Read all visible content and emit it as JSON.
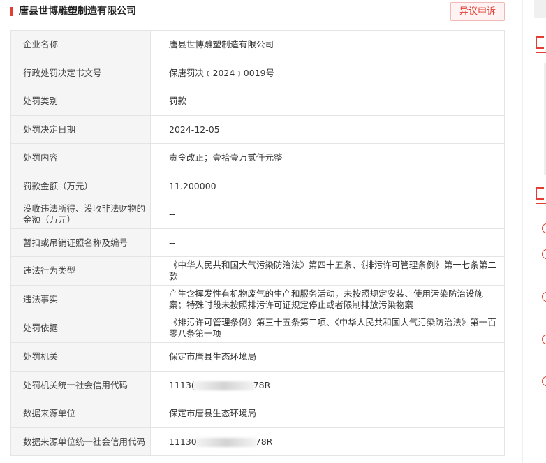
{
  "header": {
    "title": "唐县世博雕塑制造有限公司",
    "appeal_button": "异议申诉"
  },
  "rows": [
    {
      "label": "企业名称",
      "value": "唐县世博雕塑制造有限公司"
    },
    {
      "label": "行政处罚决定书文号",
      "value": "保唐罚决﹝2024﹞0019号"
    },
    {
      "label": "处罚类别",
      "value": "罚款"
    },
    {
      "label": "处罚决定日期",
      "value": "2024-12-05"
    },
    {
      "label": "处罚内容",
      "value": "责令改正；壹拾壹万贰仟元整"
    },
    {
      "label": "罚款金额（万元）",
      "value": "11.200000"
    },
    {
      "label": "没收违法所得、没收非法财物的金额（万元）",
      "value": "--"
    },
    {
      "label": "暂扣或吊销证照名称及编号",
      "value": "--"
    },
    {
      "label": "违法行为类型",
      "value": "《中华人民共和国大气污染防治法》第四十五条、《排污许可管理条例》第十七条第二款"
    },
    {
      "label": "违法事实",
      "value": "产生含挥发性有机物废气的生产和服务活动，未按照规定安装、使用污染防治设施案；特殊时段未按照排污许可证规定停止或者限制排放污染物案"
    },
    {
      "label": "处罚依据",
      "value": "《排污许可管理条例》第三十五条第二项、《中华人民共和国大气污染防治法》第一百零八条第一项"
    },
    {
      "label": "处罚机关",
      "value": "保定市唐县生态环境局"
    },
    {
      "label": "处罚机关统一社会信用代码",
      "value_prefix": "1113(",
      "value_suffix": "78R"
    },
    {
      "label": "数据来源单位",
      "value": "保定市唐县生态环境局"
    },
    {
      "label": "数据来源单位统一社会信用代码",
      "value_prefix": "11130",
      "value_suffix": "78R"
    }
  ],
  "colors": {
    "accent": "#e33e33",
    "label_bg": "#f5f5f5",
    "border": "#e4e4e4"
  }
}
